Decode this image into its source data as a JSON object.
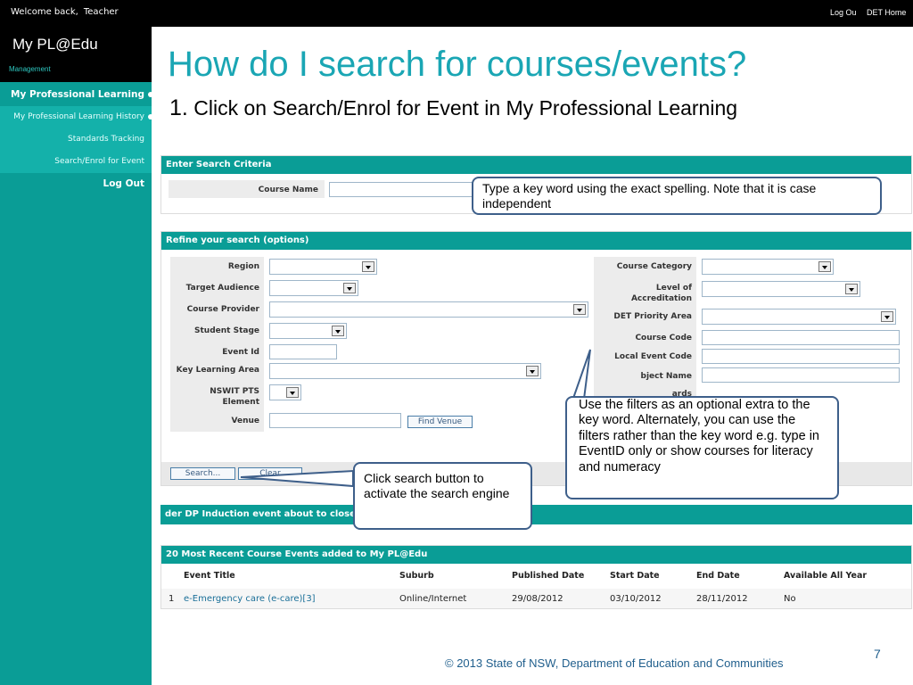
{
  "topbar": {
    "welcome": "Welcome back,",
    "user": "Teacher",
    "logout": "Log Ou",
    "det_home": "DET Home"
  },
  "sidebar": {
    "brand": "My PL@Edu",
    "management": "Management",
    "items": [
      {
        "label": "My Professional Learning"
      },
      {
        "label": "My Professional Learning History"
      },
      {
        "label": "Standards Tracking"
      },
      {
        "label": "Search/Enrol for Event"
      },
      {
        "label": "Log Out"
      }
    ]
  },
  "slide": {
    "title": "How do I search for courses/events?",
    "step_num": "1.",
    "step_text": "Click on Search/Enrol for Event in My Professional Learning"
  },
  "search_criteria": {
    "heading": "Enter Search Criteria",
    "course_name_label": "Course Name",
    "course_name_value": ""
  },
  "refine": {
    "heading": "Refine your search (options)",
    "left_labels": [
      "Region",
      "Target Audience",
      "Course Provider",
      "Student Stage",
      "Event Id",
      "Key Learning Area",
      "NSWIT PTS Element",
      "Venue"
    ],
    "right_labels": [
      "Course Category",
      "Level of Accreditation",
      "DET Priority Area",
      "Course Code",
      "Local Event Code",
      "bject Name",
      "ards"
    ],
    "find_venue": "Find Venue",
    "search_button": "Search...",
    "clear_button": "Clear"
  },
  "banner": {
    "text": "der DP Induction event about to close"
  },
  "recent": {
    "heading": "20 Most Recent Course Events added to My PL@Edu",
    "columns": [
      "Event Title",
      "Suburb",
      "Published Date",
      "Start Date",
      "End Date",
      "Available All Year"
    ],
    "rows": [
      {
        "num": "1",
        "title": "e-Emergency care (e-care)[3]",
        "suburb": "Online/Internet",
        "published": "29/08/2012",
        "start": "03/10/2012",
        "end": "28/11/2012",
        "all_year": "No"
      }
    ]
  },
  "callouts": {
    "keyword": "Type a key word using the exact spelling. Note that it is case independent",
    "filters": "Use the filters as an optional extra to the key word. Alternately, you can use the filters rather than the key word  e.g. type in EventID only or show courses for literacy and numeracy",
    "search": "Click search button to activate the search engine"
  },
  "footer": {
    "copyright": "© 2013 State of NSW, Department of Education and Communities",
    "page": "7"
  },
  "colors": {
    "teal": "#0a9d96",
    "title_blue": "#1aa6b4",
    "callout_border": "#3e5f8a"
  }
}
